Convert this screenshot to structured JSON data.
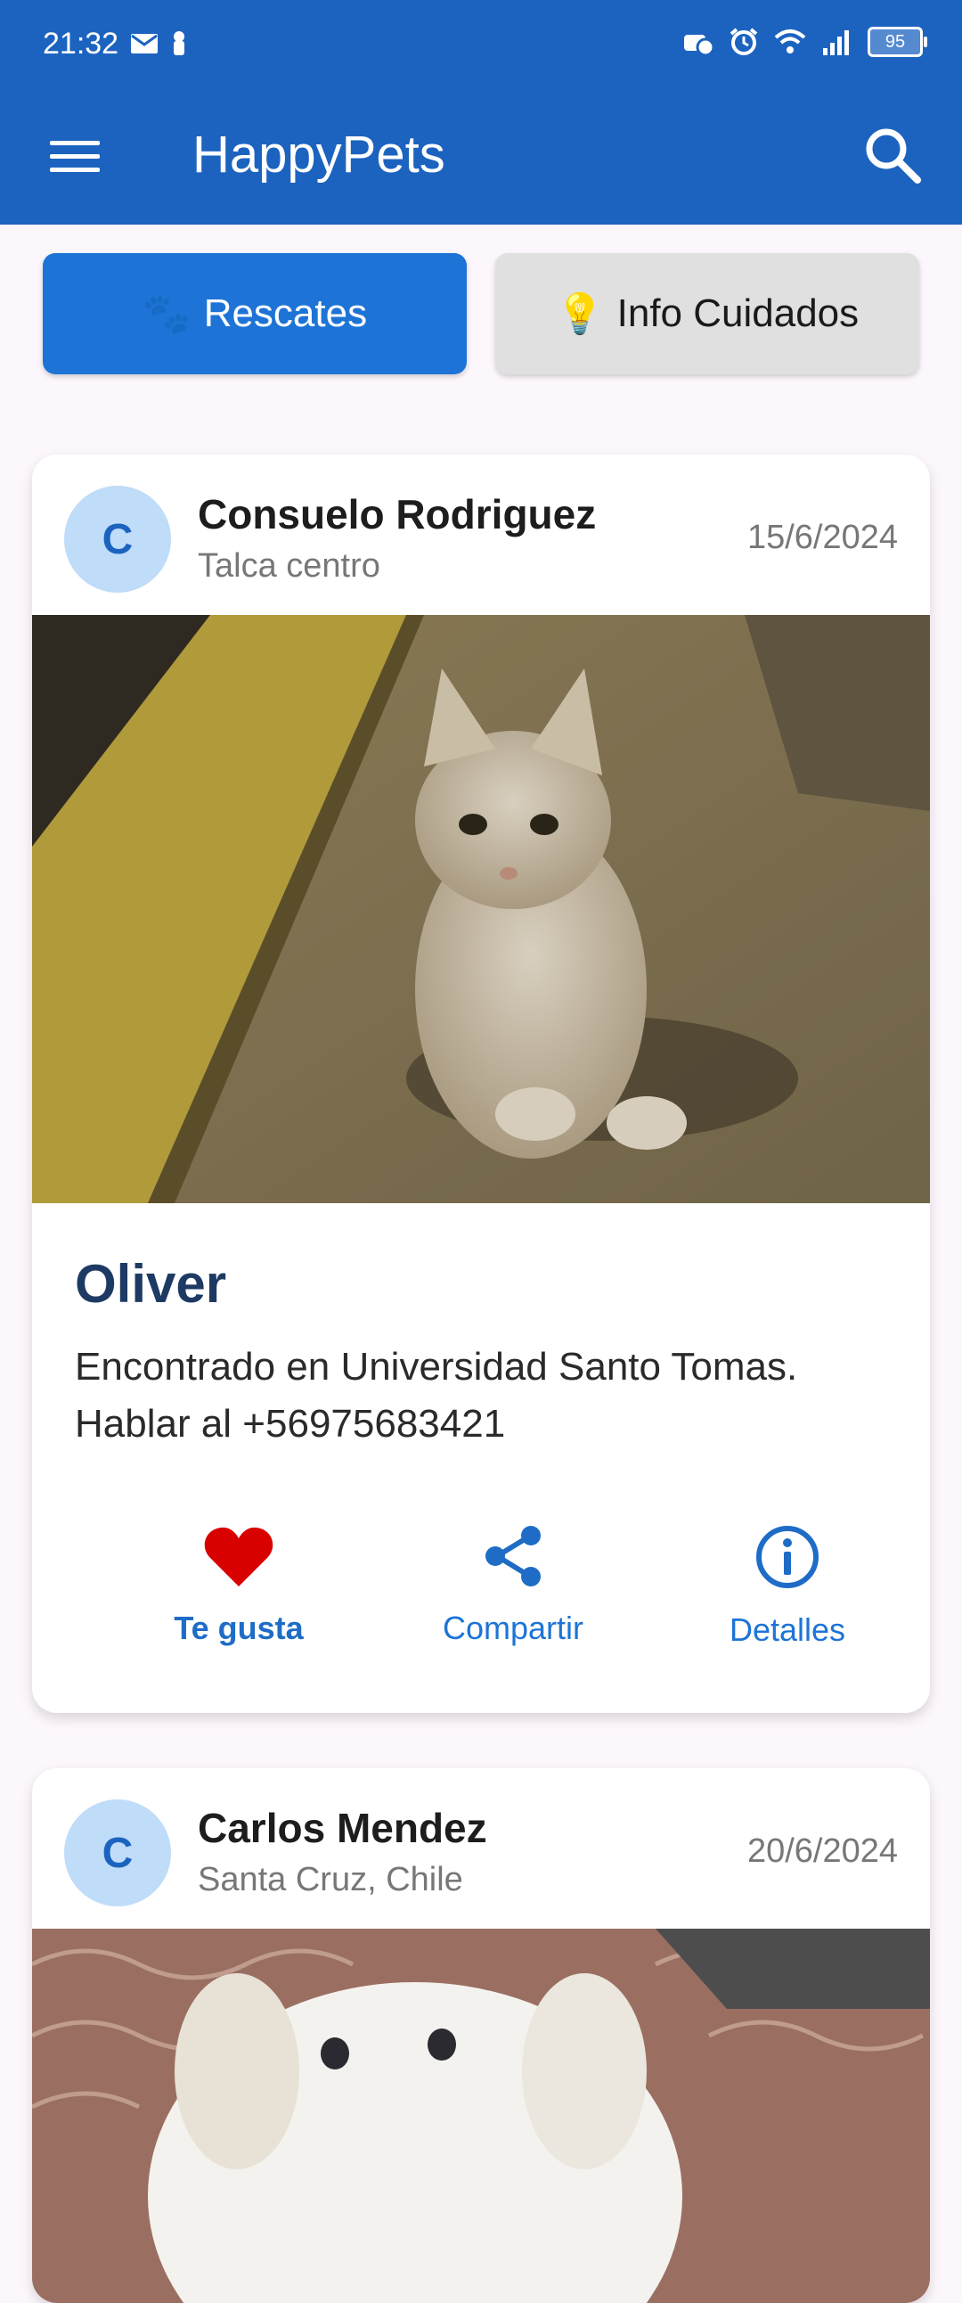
{
  "status_bar": {
    "time": "21:32",
    "battery": "95",
    "left_icons": [
      "mail-icon",
      "notification-icon"
    ],
    "right_icons": [
      "data-saver-icon",
      "alarm-icon",
      "wifi-icon",
      "signal-icon",
      "battery-icon"
    ]
  },
  "app_bar": {
    "title": "HappyPets",
    "menu_icon": "menu-icon",
    "search_icon": "search-icon"
  },
  "tabs": {
    "rescates": {
      "emoji": "🐾",
      "label": "Rescates"
    },
    "info": {
      "emoji": "💡",
      "label": "Info Cuidados"
    }
  },
  "posts": [
    {
      "avatar_initial": "C",
      "author": "Consuelo Rodriguez",
      "location": "Talca centro",
      "date": "15/6/2024",
      "pet_name": "Oliver",
      "description": "Encontrado en Universidad Santo Tomas. Hablar al +56975683421",
      "actions": {
        "like": "Te gusta",
        "share": "Compartir",
        "details": "Detalles"
      }
    },
    {
      "avatar_initial": "C",
      "author": "Carlos Mendez",
      "location": "Santa Cruz, Chile",
      "date": "20/6/2024"
    }
  ],
  "colors": {
    "primary": "#1c63c0",
    "chip_active": "#1d74d6",
    "like": "#d90000"
  }
}
